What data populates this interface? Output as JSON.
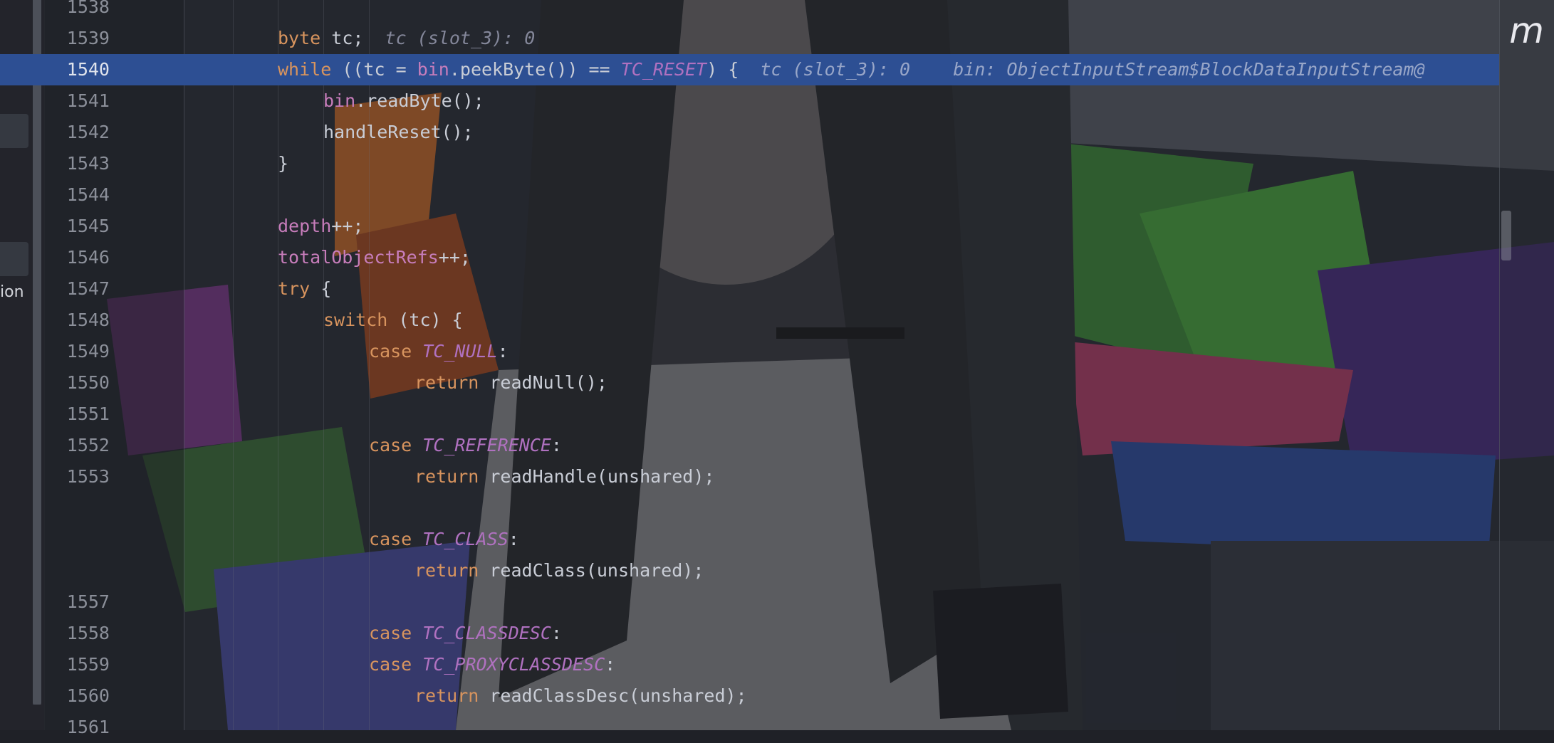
{
  "editor": {
    "logo_text": "m",
    "side_label": "ion",
    "current_line": "1540",
    "lines": [
      {
        "n": "1538",
        "indent": 0,
        "tokens": []
      },
      {
        "n": "1539",
        "indent": 0,
        "tokens": [
          [
            "kw",
            "byte"
          ],
          [
            "txt",
            " tc;  "
          ],
          [
            "hint",
            "tc (slot_3): 0"
          ]
        ]
      },
      {
        "n": "1540",
        "indent": 0,
        "tokens": [
          [
            "kw",
            "while"
          ],
          [
            "txt",
            " ((tc = "
          ],
          [
            "fld",
            "bin"
          ],
          [
            "txt",
            ".peekByte()) == "
          ],
          [
            "const",
            "TC_RESET"
          ],
          [
            "txt",
            ") {  "
          ],
          [
            "hint",
            "tc (slot_3): 0    bin: ObjectInputStream$BlockDataInputStream@"
          ]
        ]
      },
      {
        "n": "1541",
        "indent": 1,
        "tokens": [
          [
            "fld",
            "bin"
          ],
          [
            "txt",
            ".readByte();"
          ]
        ]
      },
      {
        "n": "1542",
        "indent": 1,
        "tokens": [
          [
            "txt",
            "handleReset();"
          ]
        ]
      },
      {
        "n": "1543",
        "indent": 0,
        "tokens": [
          [
            "txt",
            "}"
          ]
        ]
      },
      {
        "n": "1544",
        "indent": 0,
        "tokens": []
      },
      {
        "n": "1545",
        "indent": 0,
        "tokens": [
          [
            "fld",
            "depth"
          ],
          [
            "txt",
            "++;"
          ]
        ]
      },
      {
        "n": "1546",
        "indent": 0,
        "tokens": [
          [
            "fld",
            "totalObjectRefs"
          ],
          [
            "txt",
            "++;"
          ]
        ]
      },
      {
        "n": "1547",
        "indent": 0,
        "tokens": [
          [
            "kw",
            "try"
          ],
          [
            "txt",
            " {"
          ]
        ]
      },
      {
        "n": "1548",
        "indent": 1,
        "tokens": [
          [
            "kw",
            "switch"
          ],
          [
            "txt",
            " (tc) {"
          ]
        ]
      },
      {
        "n": "1549",
        "indent": 2,
        "tokens": [
          [
            "kw",
            "case"
          ],
          [
            "txt",
            " "
          ],
          [
            "const",
            "TC_NULL"
          ],
          [
            "txt",
            ":"
          ]
        ]
      },
      {
        "n": "1550",
        "indent": 3,
        "tokens": [
          [
            "kw",
            "return"
          ],
          [
            "txt",
            " readNull();"
          ]
        ]
      },
      {
        "n": "1551",
        "indent": 0,
        "tokens": []
      },
      {
        "n": "1552",
        "indent": 2,
        "tokens": [
          [
            "kw",
            "case"
          ],
          [
            "txt",
            " "
          ],
          [
            "const",
            "TC_REFERENCE"
          ],
          [
            "txt",
            ":"
          ]
        ]
      },
      {
        "n": "1553",
        "indent": 3,
        "tokens": [
          [
            "kw",
            "return"
          ],
          [
            "txt",
            " readHandle(unshared);"
          ]
        ]
      },
      {
        "n": "",
        "indent": 0,
        "tokens": []
      },
      {
        "n": "",
        "indent": 2,
        "tokens": [
          [
            "kw",
            "case"
          ],
          [
            "txt",
            " "
          ],
          [
            "const",
            "TC_CLASS"
          ],
          [
            "txt",
            ":"
          ]
        ]
      },
      {
        "n": "",
        "indent": 3,
        "tokens": [
          [
            "kw",
            "return"
          ],
          [
            "txt",
            " readClass(unshared);"
          ]
        ]
      },
      {
        "n": "1557",
        "indent": 0,
        "tokens": []
      },
      {
        "n": "1558",
        "indent": 2,
        "tokens": [
          [
            "kw",
            "case"
          ],
          [
            "txt",
            " "
          ],
          [
            "const",
            "TC_CLASSDESC"
          ],
          [
            "txt",
            ":"
          ]
        ]
      },
      {
        "n": "1559",
        "indent": 2,
        "tokens": [
          [
            "kw",
            "case"
          ],
          [
            "txt",
            " "
          ],
          [
            "const",
            "TC_PROXYCLASSDESC"
          ],
          [
            "txt",
            ":"
          ]
        ]
      },
      {
        "n": "1560",
        "indent": 3,
        "tokens": [
          [
            "kw",
            "return"
          ],
          [
            "txt",
            " readClassDesc(unshared);"
          ]
        ]
      },
      {
        "n": "1561",
        "indent": 0,
        "tokens": []
      }
    ]
  },
  "colors": {
    "keyword": "#d8945e",
    "field": "#c77dbb",
    "constant": "#b071c0",
    "hint": "#84879a",
    "current_line_bg": "#2d4f93"
  },
  "icons": [
    "scrollbar-thumb",
    "wallpaper-image"
  ]
}
